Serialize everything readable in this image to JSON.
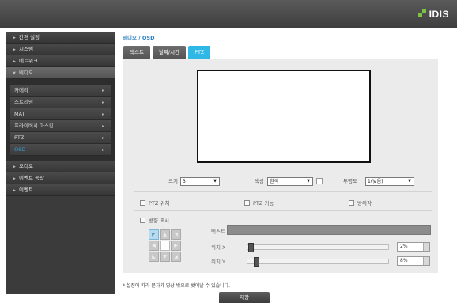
{
  "brand": {
    "logo_text": "IDIS",
    "accent": "#7cc242"
  },
  "sidebar": {
    "items": [
      {
        "label": "간편 설정"
      },
      {
        "label": "시스템"
      },
      {
        "label": "네트워크"
      },
      {
        "label": "비디오"
      },
      {
        "label": "오디오"
      },
      {
        "label": "이벤트 동작"
      },
      {
        "label": "이벤트"
      }
    ],
    "video_sub": [
      {
        "label": "카메라"
      },
      {
        "label": "스트리밍"
      },
      {
        "label": "MAT"
      },
      {
        "label": "프라이버시 마스킹"
      },
      {
        "label": "PTZ"
      },
      {
        "label": "OSD"
      }
    ]
  },
  "breadcrumb": {
    "section": "비디오",
    "page": "OSD"
  },
  "tabs": [
    {
      "label": "텍스트"
    },
    {
      "label": "날짜/시간"
    },
    {
      "label": "PTZ"
    }
  ],
  "settings": {
    "size_label": "크기",
    "size_value": "3",
    "color_label": "색상",
    "color_value": "흰색",
    "opacity_label": "투명도",
    "opacity_value": "1(낮음)",
    "ptz_position_label": "PTZ 위치",
    "ptz_function_label": "PTZ 기능",
    "azimuth_label": "방위각",
    "direction_label": "방향 표시",
    "text_label": "텍스트",
    "pos_x_label": "위치 X",
    "pos_x_value": "2%",
    "pos_y_label": "위치 Y",
    "pos_y_value": "8%"
  },
  "footer": {
    "note": "* 설정에 따라 문자가 영상 밖으로 벗어날 수 있습니다.",
    "save_label": "저장"
  },
  "colors": {
    "active_tab": "#2fb7e6",
    "link": "#2a7fc0"
  }
}
